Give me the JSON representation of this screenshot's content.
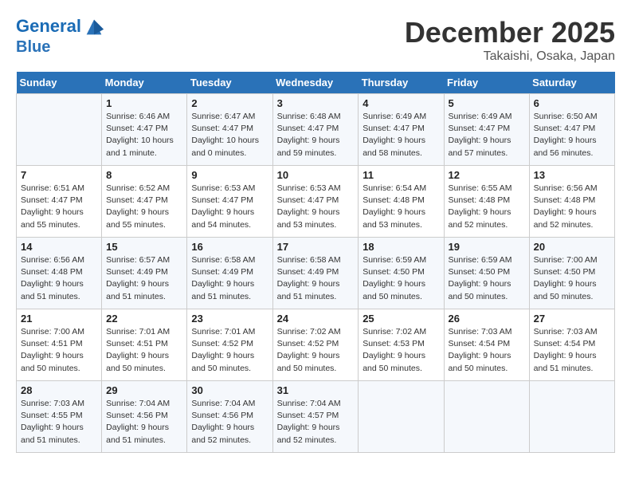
{
  "header": {
    "logo_line1": "General",
    "logo_line2": "Blue",
    "month": "December 2025",
    "location": "Takaishi, Osaka, Japan"
  },
  "days_of_week": [
    "Sunday",
    "Monday",
    "Tuesday",
    "Wednesday",
    "Thursday",
    "Friday",
    "Saturday"
  ],
  "weeks": [
    [
      {
        "day": "",
        "info": ""
      },
      {
        "day": "1",
        "info": "Sunrise: 6:46 AM\nSunset: 4:47 PM\nDaylight: 10 hours\nand 1 minute."
      },
      {
        "day": "2",
        "info": "Sunrise: 6:47 AM\nSunset: 4:47 PM\nDaylight: 10 hours\nand 0 minutes."
      },
      {
        "day": "3",
        "info": "Sunrise: 6:48 AM\nSunset: 4:47 PM\nDaylight: 9 hours\nand 59 minutes."
      },
      {
        "day": "4",
        "info": "Sunrise: 6:49 AM\nSunset: 4:47 PM\nDaylight: 9 hours\nand 58 minutes."
      },
      {
        "day": "5",
        "info": "Sunrise: 6:49 AM\nSunset: 4:47 PM\nDaylight: 9 hours\nand 57 minutes."
      },
      {
        "day": "6",
        "info": "Sunrise: 6:50 AM\nSunset: 4:47 PM\nDaylight: 9 hours\nand 56 minutes."
      }
    ],
    [
      {
        "day": "7",
        "info": "Sunrise: 6:51 AM\nSunset: 4:47 PM\nDaylight: 9 hours\nand 55 minutes."
      },
      {
        "day": "8",
        "info": "Sunrise: 6:52 AM\nSunset: 4:47 PM\nDaylight: 9 hours\nand 55 minutes."
      },
      {
        "day": "9",
        "info": "Sunrise: 6:53 AM\nSunset: 4:47 PM\nDaylight: 9 hours\nand 54 minutes."
      },
      {
        "day": "10",
        "info": "Sunrise: 6:53 AM\nSunset: 4:47 PM\nDaylight: 9 hours\nand 53 minutes."
      },
      {
        "day": "11",
        "info": "Sunrise: 6:54 AM\nSunset: 4:48 PM\nDaylight: 9 hours\nand 53 minutes."
      },
      {
        "day": "12",
        "info": "Sunrise: 6:55 AM\nSunset: 4:48 PM\nDaylight: 9 hours\nand 52 minutes."
      },
      {
        "day": "13",
        "info": "Sunrise: 6:56 AM\nSunset: 4:48 PM\nDaylight: 9 hours\nand 52 minutes."
      }
    ],
    [
      {
        "day": "14",
        "info": "Sunrise: 6:56 AM\nSunset: 4:48 PM\nDaylight: 9 hours\nand 51 minutes."
      },
      {
        "day": "15",
        "info": "Sunrise: 6:57 AM\nSunset: 4:49 PM\nDaylight: 9 hours\nand 51 minutes."
      },
      {
        "day": "16",
        "info": "Sunrise: 6:58 AM\nSunset: 4:49 PM\nDaylight: 9 hours\nand 51 minutes."
      },
      {
        "day": "17",
        "info": "Sunrise: 6:58 AM\nSunset: 4:49 PM\nDaylight: 9 hours\nand 51 minutes."
      },
      {
        "day": "18",
        "info": "Sunrise: 6:59 AM\nSunset: 4:50 PM\nDaylight: 9 hours\nand 50 minutes."
      },
      {
        "day": "19",
        "info": "Sunrise: 6:59 AM\nSunset: 4:50 PM\nDaylight: 9 hours\nand 50 minutes."
      },
      {
        "day": "20",
        "info": "Sunrise: 7:00 AM\nSunset: 4:50 PM\nDaylight: 9 hours\nand 50 minutes."
      }
    ],
    [
      {
        "day": "21",
        "info": "Sunrise: 7:00 AM\nSunset: 4:51 PM\nDaylight: 9 hours\nand 50 minutes."
      },
      {
        "day": "22",
        "info": "Sunrise: 7:01 AM\nSunset: 4:51 PM\nDaylight: 9 hours\nand 50 minutes."
      },
      {
        "day": "23",
        "info": "Sunrise: 7:01 AM\nSunset: 4:52 PM\nDaylight: 9 hours\nand 50 minutes."
      },
      {
        "day": "24",
        "info": "Sunrise: 7:02 AM\nSunset: 4:52 PM\nDaylight: 9 hours\nand 50 minutes."
      },
      {
        "day": "25",
        "info": "Sunrise: 7:02 AM\nSunset: 4:53 PM\nDaylight: 9 hours\nand 50 minutes."
      },
      {
        "day": "26",
        "info": "Sunrise: 7:03 AM\nSunset: 4:54 PM\nDaylight: 9 hours\nand 50 minutes."
      },
      {
        "day": "27",
        "info": "Sunrise: 7:03 AM\nSunset: 4:54 PM\nDaylight: 9 hours\nand 51 minutes."
      }
    ],
    [
      {
        "day": "28",
        "info": "Sunrise: 7:03 AM\nSunset: 4:55 PM\nDaylight: 9 hours\nand 51 minutes."
      },
      {
        "day": "29",
        "info": "Sunrise: 7:04 AM\nSunset: 4:56 PM\nDaylight: 9 hours\nand 51 minutes."
      },
      {
        "day": "30",
        "info": "Sunrise: 7:04 AM\nSunset: 4:56 PM\nDaylight: 9 hours\nand 52 minutes."
      },
      {
        "day": "31",
        "info": "Sunrise: 7:04 AM\nSunset: 4:57 PM\nDaylight: 9 hours\nand 52 minutes."
      },
      {
        "day": "",
        "info": ""
      },
      {
        "day": "",
        "info": ""
      },
      {
        "day": "",
        "info": ""
      }
    ]
  ]
}
